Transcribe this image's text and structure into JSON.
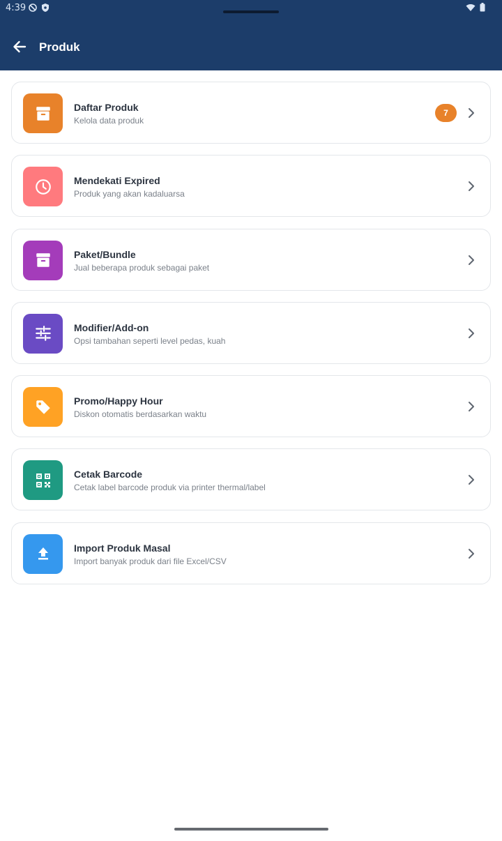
{
  "status_bar": {
    "time": "4:39"
  },
  "app_bar": {
    "title": "Produk"
  },
  "menu": [
    {
      "title": "Daftar Produk",
      "subtitle": "Kelola data produk",
      "badge": "7",
      "icon": "archive-box-icon",
      "color": "#e8822a"
    },
    {
      "title": "Mendekati Expired",
      "subtitle": "Produk yang akan kadaluarsa",
      "icon": "clock-icon",
      "color": "#ff7a7e"
    },
    {
      "title": "Paket/Bundle",
      "subtitle": "Jual beberapa produk sebagai paket",
      "icon": "archive-box-icon",
      "color": "#a43cba"
    },
    {
      "title": "Modifier/Add-on",
      "subtitle": "Opsi tambahan seperti level pedas, kuah",
      "icon": "sliders-icon",
      "color": "#6a4bc4"
    },
    {
      "title": "Promo/Happy Hour",
      "subtitle": "Diskon otomatis berdasarkan waktu",
      "icon": "tag-icon",
      "color": "#ffa224"
    },
    {
      "title": "Cetak Barcode",
      "subtitle": "Cetak label barcode produk via printer thermal/label",
      "icon": "qr-code-icon",
      "color": "#1f9a82"
    },
    {
      "title": "Import Produk Masal",
      "subtitle": "Import banyak produk dari file Excel/CSV",
      "icon": "upload-icon",
      "color": "#3598ee"
    }
  ]
}
